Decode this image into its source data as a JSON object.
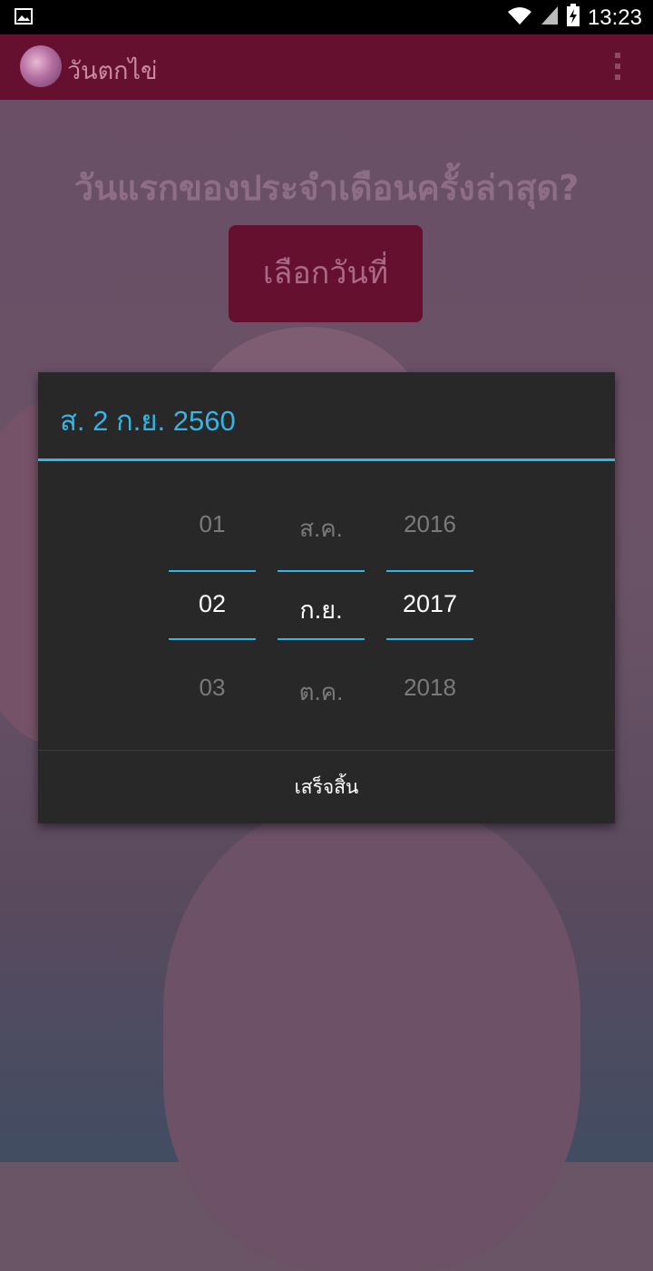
{
  "status_bar": {
    "time": "13:23",
    "icons": [
      "image-icon",
      "wifi-icon",
      "signal-icon",
      "battery-charging-icon"
    ]
  },
  "app_bar": {
    "title": "วันตกไข่",
    "icon": "app-logo-icon",
    "overflow_icon": "overflow-menu-icon"
  },
  "main": {
    "question": "วันแรกของประจำเดือนครั้งล่าสุด?",
    "pick_date_button": "เลือกวันที่"
  },
  "dialog": {
    "title": "ส. 2 ก.ย. 2560",
    "day": {
      "prev": "01",
      "selected": "02",
      "next": "03"
    },
    "month": {
      "prev": "ส.ค.",
      "selected": "ก.ย.",
      "next": "ต.ค."
    },
    "year": {
      "prev": "2016",
      "selected": "2017",
      "next": "2018"
    },
    "done_label": "เสร็จสิ้น"
  },
  "colors": {
    "accent": "#33b5e5",
    "app_bar": "#64102e",
    "dialog_bg": "#282828"
  }
}
